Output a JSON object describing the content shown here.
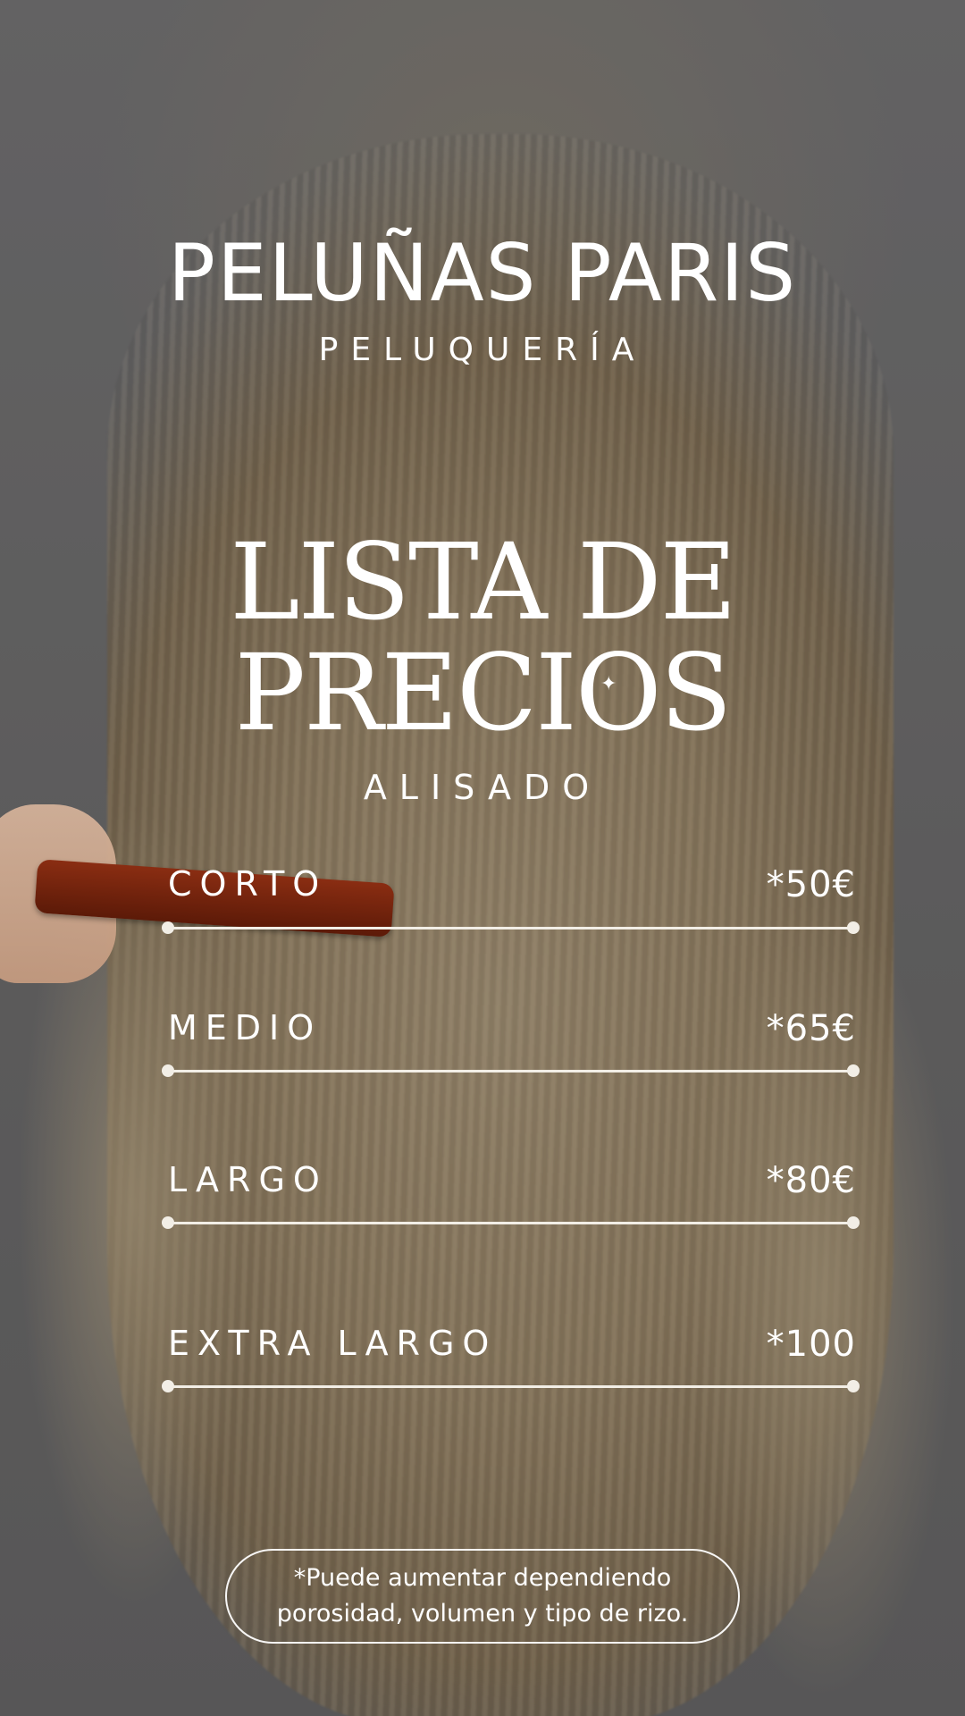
{
  "header": {
    "brand": "PELUÑAS PARIS",
    "subtitle": "PELUQUERÍA"
  },
  "title": {
    "line1": "LISTA DE",
    "line2": "PRECIOS",
    "sparkle_icon": "sparkle-icon"
  },
  "category": "ALISADO",
  "prices": [
    {
      "label": "CORTO",
      "value": "*50€"
    },
    {
      "label": "MEDIO",
      "value": "*65€"
    },
    {
      "label": "LARGO",
      "value": "*80€"
    },
    {
      "label": "EXTRA LARGO",
      "value": "*100"
    }
  ],
  "note": {
    "line1": "*Puede aumentar dependiendo",
    "line2": "porosidad, volumen y tipo de rizo."
  },
  "colors": {
    "text": "#ffffff",
    "line": "#f2eee6",
    "background": "#6b6a6c",
    "comb": "#7a250f"
  }
}
